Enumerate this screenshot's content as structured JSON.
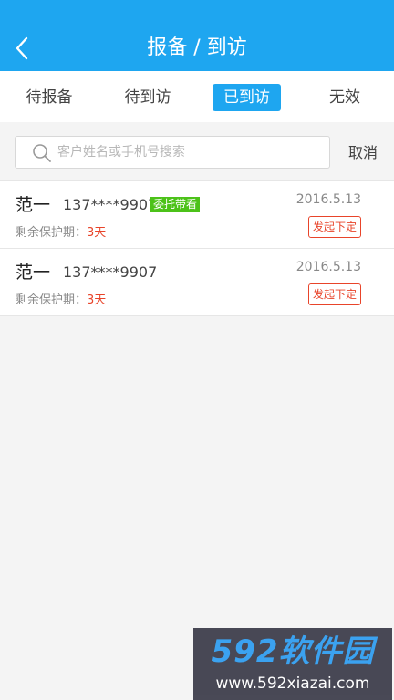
{
  "header": {
    "title": "报备 / 到访",
    "back_icon": "chevron-left-icon",
    "bg_color": "#1ea6f0"
  },
  "tabs": [
    {
      "label": "待报备",
      "active": false
    },
    {
      "label": "待到访",
      "active": false
    },
    {
      "label": "已到访",
      "active": true
    },
    {
      "label": "无效",
      "active": false
    }
  ],
  "search": {
    "placeholder": "客户姓名或手机号搜索",
    "value": "",
    "cancel_label": "取消",
    "icon": "search-icon"
  },
  "list": [
    {
      "name": "范一",
      "phone": "137****9907",
      "tag": "委托带看",
      "protect_label": "剩余保护期：",
      "protect_days": "3天",
      "date": "2016.5.13",
      "action_label": "发起下定"
    },
    {
      "name": "范一",
      "phone": "137****9907",
      "tag": "",
      "protect_label": "剩余保护期：",
      "protect_days": "3天",
      "date": "2016.5.13",
      "action_label": "发起下定"
    }
  ],
  "watermark": {
    "brand": "592软件园",
    "url": "www.592xiazai.com"
  },
  "colors": {
    "accent": "#1ea6f0",
    "tag_green": "#4cc219",
    "alert_red": "#e8442a"
  }
}
